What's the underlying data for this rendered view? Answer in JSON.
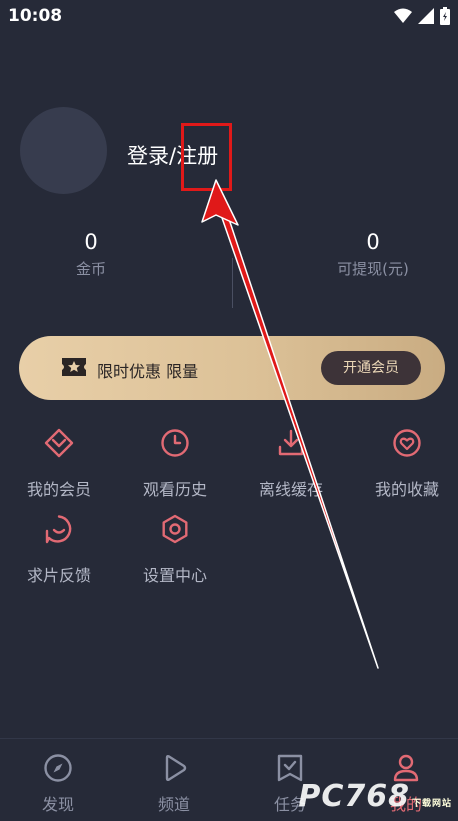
{
  "status_bar": {
    "time": "10:08"
  },
  "profile": {
    "login_label": "登录/注册"
  },
  "stats": [
    {
      "value": "0",
      "label": "金币"
    },
    {
      "value": "0",
      "label": "可提现(元)"
    }
  ],
  "vip_banner": {
    "text": "限时优惠 限量",
    "button_label": "开通会员"
  },
  "menu": [
    {
      "label": "我的会员",
      "icon": "vip-diamond-icon"
    },
    {
      "label": "观看历史",
      "icon": "clock-icon"
    },
    {
      "label": "离线缓存",
      "icon": "download-icon"
    },
    {
      "label": "我的收藏",
      "icon": "heart-icon"
    },
    {
      "label": "求片反馈",
      "icon": "feedback-icon"
    },
    {
      "label": "设置中心",
      "icon": "settings-icon"
    }
  ],
  "tabs": [
    {
      "label": "发现",
      "icon": "compass-icon"
    },
    {
      "label": "频道",
      "icon": "play-icon"
    },
    {
      "label": "任务",
      "icon": "task-icon"
    },
    {
      "label": "我的",
      "icon": "user-icon",
      "active": true
    }
  ],
  "colors": {
    "background": "#262a38",
    "accent": "#e26a74",
    "vip_gold": "#dcc197"
  },
  "watermark": {
    "text": "PC768",
    "sub": "下载网站"
  }
}
